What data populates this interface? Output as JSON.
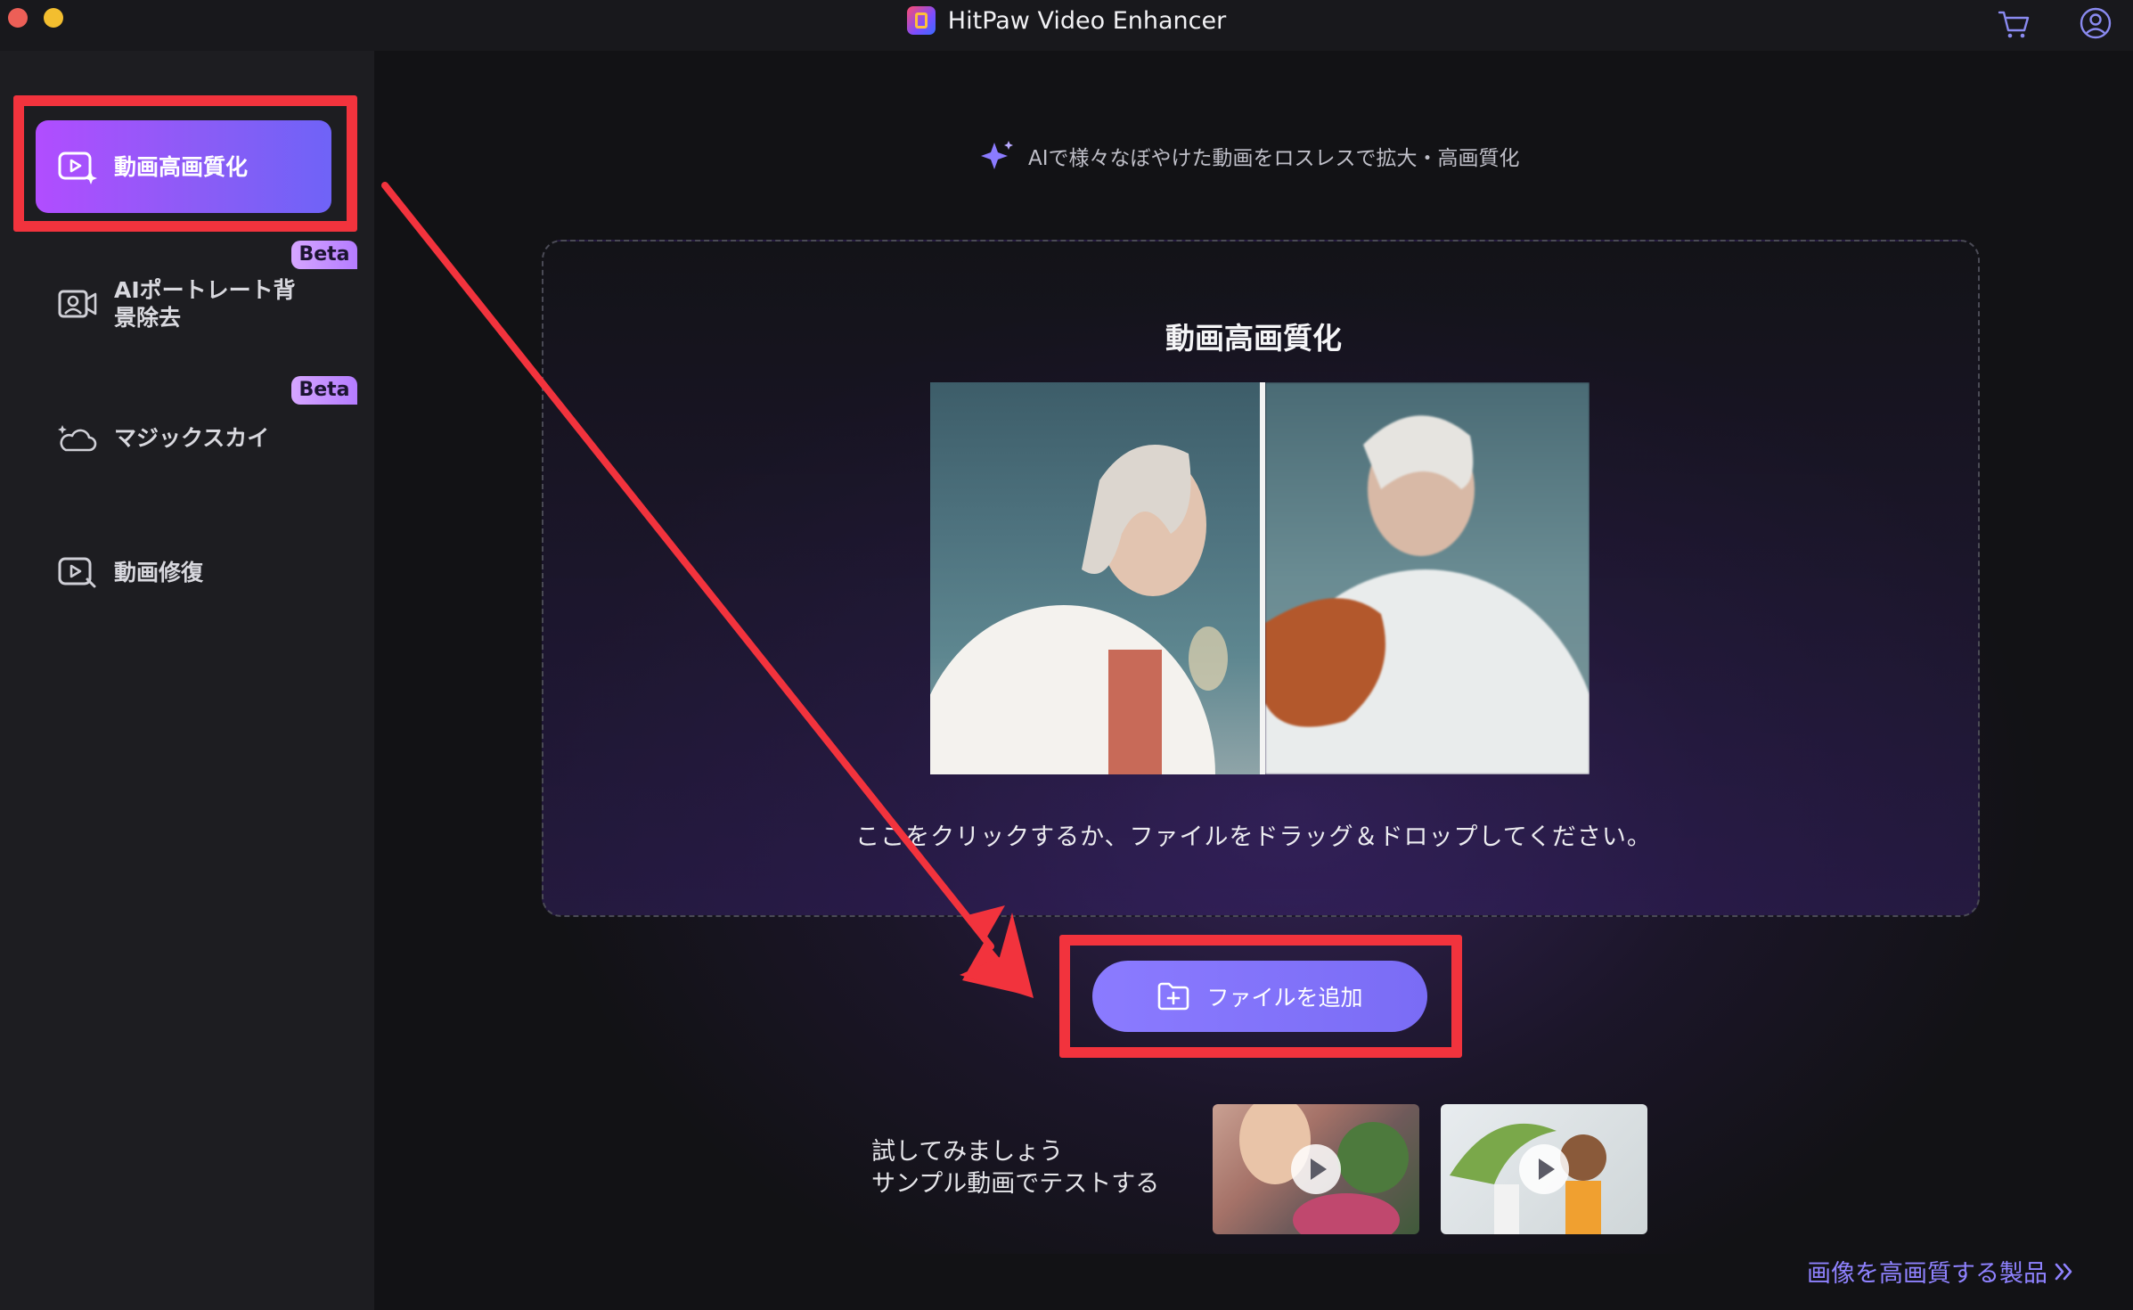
{
  "window": {
    "title": "HitPaw Video Enhancer",
    "icons": [
      "cart-icon",
      "user-account-icon"
    ]
  },
  "sidebar": {
    "items": [
      {
        "label": "動画高画質化",
        "icon": "video-enhance-icon",
        "active": true
      },
      {
        "label": "AIポートレート背景除去",
        "label_lines": [
          "AIポートレート背",
          "景除去"
        ],
        "icon": "portrait-camera-icon",
        "badge": "Beta"
      },
      {
        "label": "マジックスカイ",
        "icon": "sky-cloud-icon",
        "badge": "Beta"
      },
      {
        "label": "動画修復",
        "icon": "video-repair-icon"
      }
    ]
  },
  "main": {
    "tagline": "AIで様々なぼやけた動画をロスレスで拡大・高画質化",
    "drop_zone": {
      "title": "動画高画質化",
      "hint": "ここをクリックするか、ファイルをドラッグ＆ドロップしてください。"
    },
    "add_file_button": "ファイルを追加",
    "try_line1": "試してみましょう",
    "try_line2": "サンプル動画でテストする",
    "samples": [
      "sample-video-1",
      "sample-video-2"
    ],
    "footer_link": "画像を高画質する製品"
  },
  "colors": {
    "accent": "#8b7bff",
    "active_gradient_start": "#b14dff",
    "annotation_red": "#f2333d",
    "link": "#8f82ff"
  }
}
